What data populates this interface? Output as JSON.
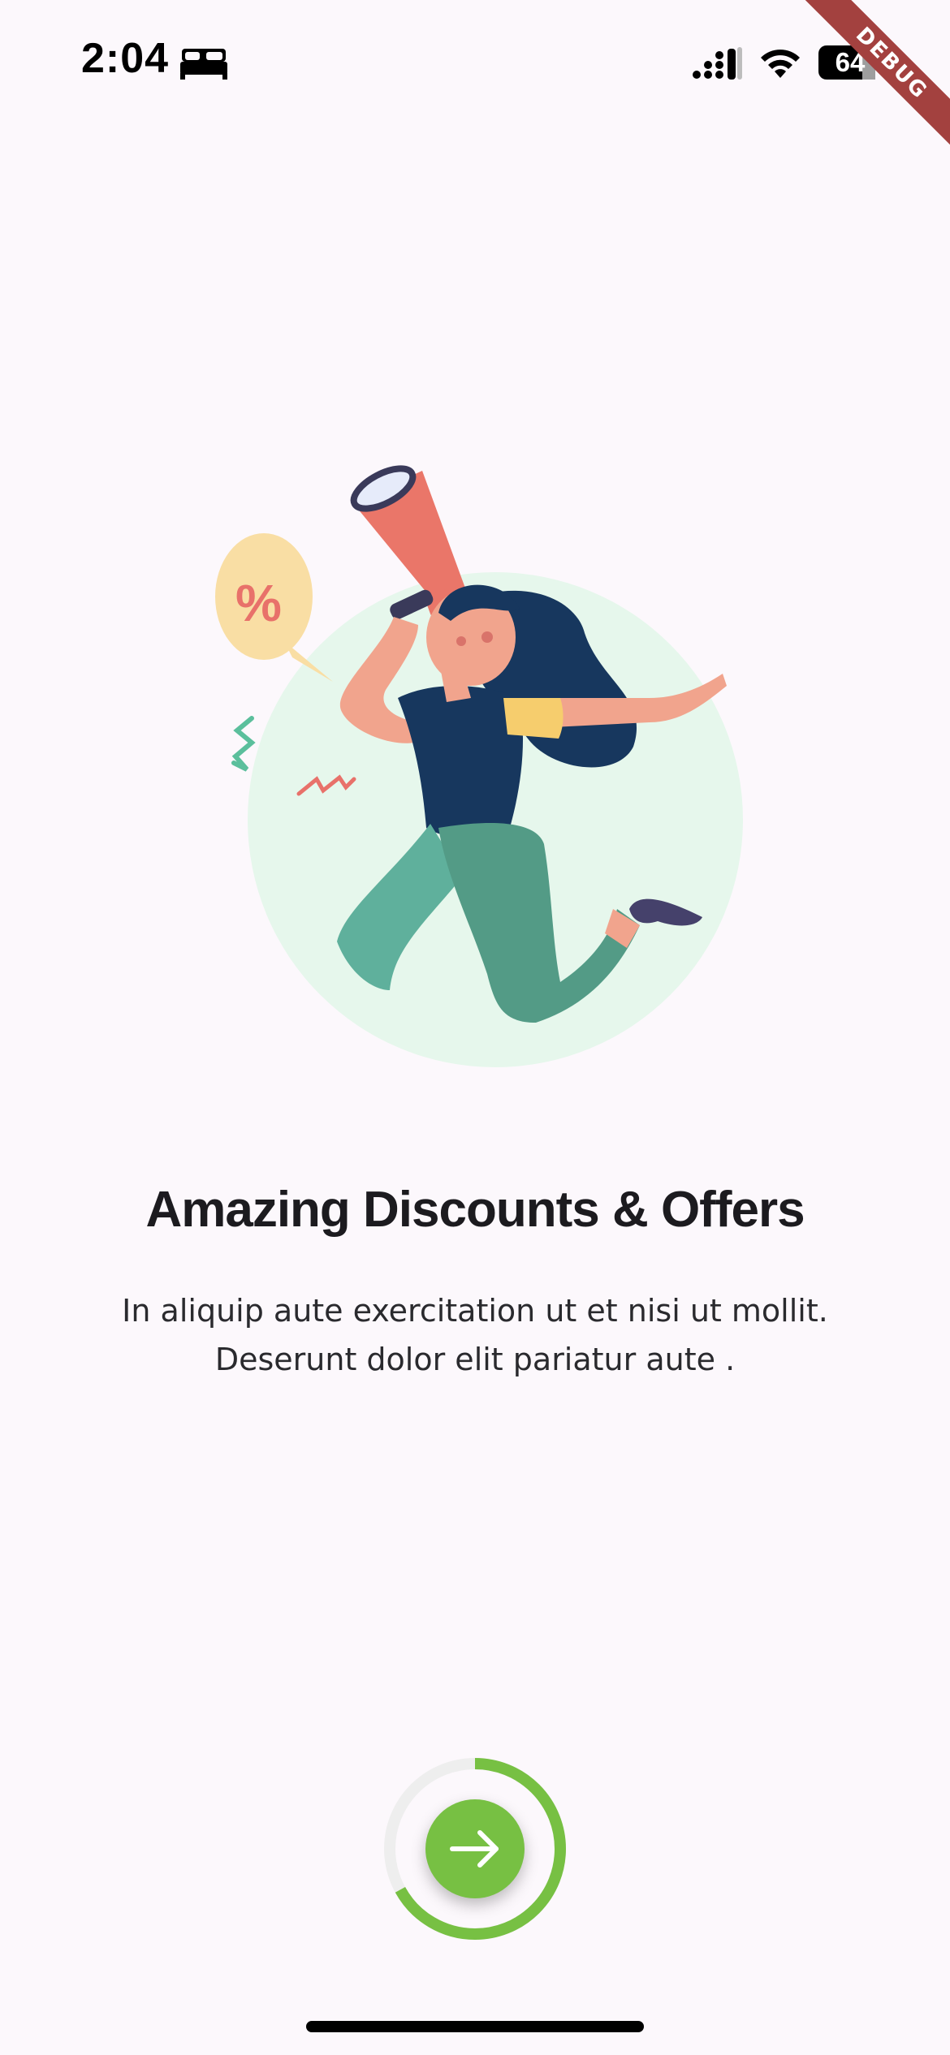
{
  "status_bar": {
    "time": "2:04",
    "battery_level": "64",
    "icons": [
      "bed-icon",
      "cellular-signal-icon",
      "wifi-icon",
      "battery-icon"
    ]
  },
  "debug_banner": {
    "label": "DEBUG",
    "color": "#a3413f"
  },
  "onboarding": {
    "illustration": {
      "icon": "woman-with-megaphone-illustration",
      "speech_bubble_text": "%"
    },
    "title": "Amazing Discounts & Offers",
    "description_line1": "In aliquip aute exercitation ut et nisi ut mollit.",
    "description_line2": "Deserunt dolor elit pariatur aute .",
    "progress_fraction": 0.67,
    "next_button": {
      "icon": "arrow-right-icon"
    }
  },
  "colors": {
    "background": "#fcf8fc",
    "accent_green": "#77c043",
    "progress_track": "#eeeeee",
    "circle_backdrop": "#e6f7ec",
    "title": "#1c1b1f"
  }
}
